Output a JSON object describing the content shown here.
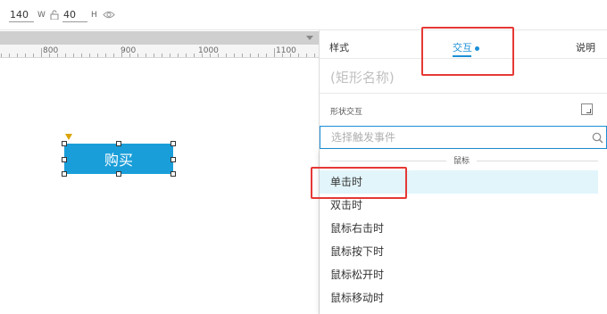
{
  "toolbar": {
    "width_value": "140",
    "width_unit": "W",
    "height_value": "40",
    "height_unit": "H"
  },
  "ruler": {
    "ticks": [
      "800",
      "900",
      "1000",
      "1100"
    ]
  },
  "canvas": {
    "widget_label": "购买"
  },
  "panel": {
    "tabs": {
      "style": "样式",
      "interaction": "交互",
      "notes": "说明"
    },
    "shape_name_placeholder": "(矩形名称)",
    "section_label": "形状交互",
    "search_placeholder": "选择触发事件",
    "group_header": "鼠标",
    "events": [
      "单击时",
      "双击时",
      "鼠标右击时",
      "鼠标按下时",
      "鼠标松开时",
      "鼠标移动时"
    ]
  },
  "colors": {
    "accent": "#1a8fd6",
    "widget_fill": "#1a9ed9",
    "highlight_row": "#e2f5fb",
    "annotation_red": "#e53935"
  }
}
